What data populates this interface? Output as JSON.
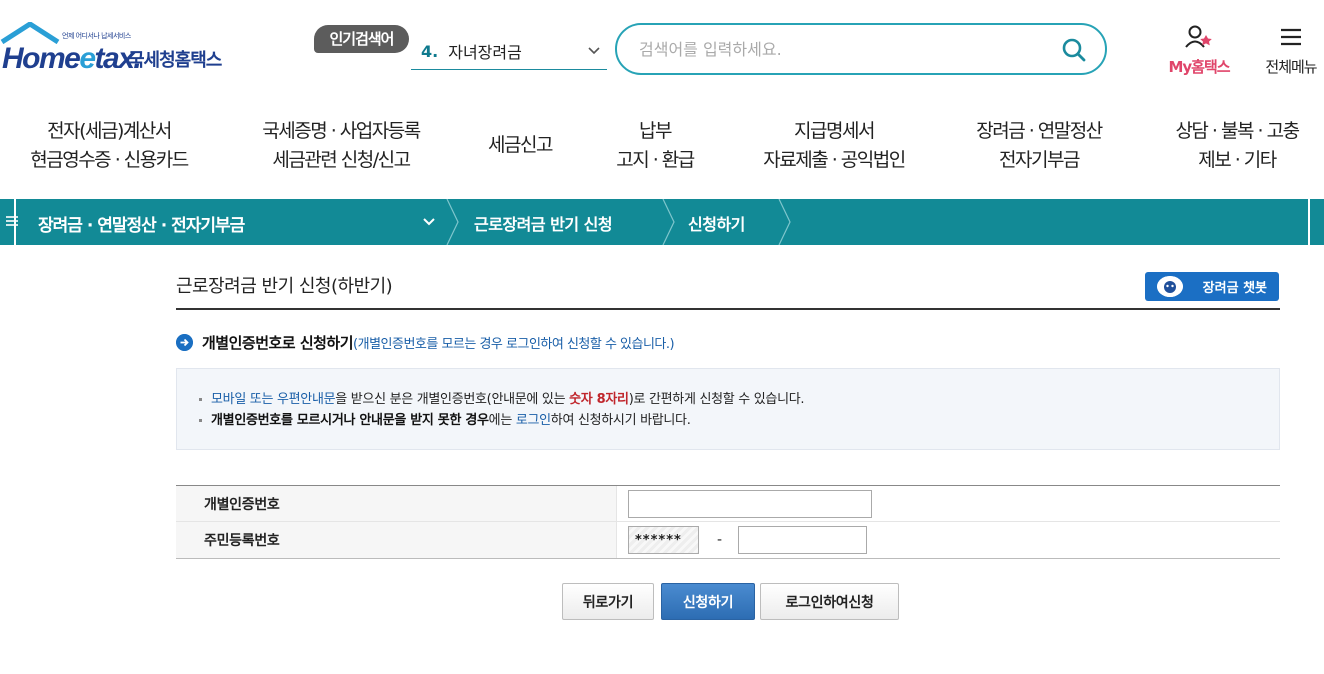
{
  "header": {
    "logo": {
      "small_text": "언제 어디서나 납세서비스",
      "word": "Home",
      "word_e": "e",
      "word_end": "tax.",
      "korean": "국세청홈택스"
    },
    "popular_badge": "인기검색어",
    "popular_select": {
      "number": "4.",
      "keyword": "자녀장려금"
    },
    "search": {
      "placeholder": "검색어를 입력하세요.",
      "value": ""
    },
    "my_hometax": "My홈택스",
    "all_menu": "전체메뉴"
  },
  "gnb": [
    {
      "line1": "전자(세금)계산서",
      "line2": "현금영수증 · 신용카드"
    },
    {
      "line1": "국세증명 · 사업자등록",
      "line2": "세금관련 신청/신고"
    },
    {
      "line1": "세금신고",
      "line2": ""
    },
    {
      "line1": "납부",
      "line2": "고지 · 환급"
    },
    {
      "line1": "지급명세서",
      "line2": "자료제출 · 공익법인"
    },
    {
      "line1": "장려금 · 연말정산",
      "line2": "전자기부금"
    },
    {
      "line1": "상담 · 불복 · 고충",
      "line2": "제보 · 기타"
    }
  ],
  "location": {
    "level1": "장려금 · 연말정산 · 전자기부금",
    "level2": "근로장려금 반기 신청",
    "level3": "신청하기"
  },
  "page": {
    "title": "근로장려금 반기 신청(하반기)",
    "chatbot": "장려금 챗봇",
    "subtitle_strong": "개별인증번호로 신청하기",
    "subtitle_note": "(개별인증번호를 모르는 경우 로그인하여 신청할 수 있습니다.)"
  },
  "info": {
    "line1": {
      "p1": "모바일 또는 우편안내문",
      "p2": "을 받으신 분은 개별인증번호(안내문에 있는 ",
      "p3": "숫자 8자리",
      "p4": ")로 간편하게 신청할 수 있습니다."
    },
    "line2": {
      "p1": "개별인증번호를 모르시거나 안내문을 받지 못한 경우",
      "p2": "에는 ",
      "p3": "로그인",
      "p4": "하여 신청하시기 바랍니다."
    }
  },
  "form": {
    "auth_label": "개별인증번호",
    "auth_value": "",
    "rrn_label": "주민등록번호",
    "rrn_front_masked": "******",
    "rrn_dash": "-",
    "rrn_back_value": ""
  },
  "buttons": {
    "back": "뒤로가기",
    "apply": "신청하기",
    "login_apply": "로그인하여신청"
  },
  "colors": {
    "teal": "#128a96",
    "navy": "#1f3f8f",
    "pink": "#e0456a",
    "primary_blue": "#2d6db3",
    "highlight_red": "#c0262c"
  }
}
